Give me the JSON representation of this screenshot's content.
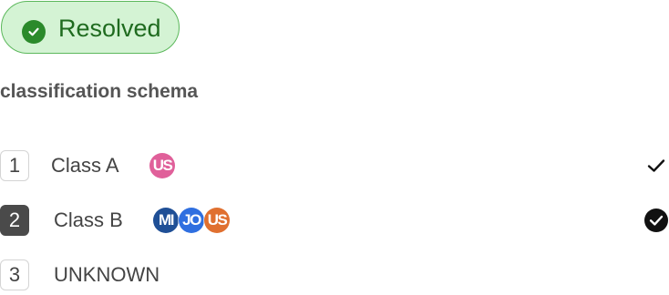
{
  "status": {
    "label": "Resolved",
    "icon": "check-circle-icon",
    "color": "#2b8a2b",
    "background": "#d4f3d4"
  },
  "schema": {
    "title": "classification schema",
    "classes": [
      {
        "number": "1",
        "label": "Class A",
        "selected": false,
        "check": "checkmark-icon",
        "annotators": [
          {
            "initials": "US",
            "color": "#e0609a"
          }
        ]
      },
      {
        "number": "2",
        "label": "Class B",
        "selected": true,
        "check": "check-circle-filled-icon",
        "annotators": [
          {
            "initials": "MI",
            "color": "#1f4f96"
          },
          {
            "initials": "JO",
            "color": "#2f6fe0"
          },
          {
            "initials": "US",
            "color": "#e07030"
          }
        ]
      },
      {
        "number": "3",
        "label": "UNKNOWN",
        "selected": false,
        "check": null,
        "annotators": []
      }
    ]
  }
}
